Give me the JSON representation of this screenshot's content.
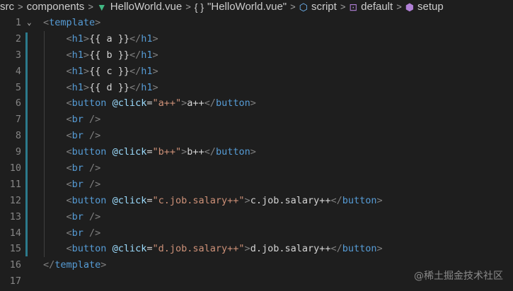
{
  "breadcrumb": {
    "segments": [
      {
        "label": "src",
        "icon": ""
      },
      {
        "label": "components",
        "icon": ""
      },
      {
        "label": "HelloWorld.vue",
        "icon": "vue-icon"
      },
      {
        "label": "\"HelloWorld.vue\"",
        "icon": "braces-icon"
      },
      {
        "label": "script",
        "icon": "cube-icon"
      },
      {
        "label": "default",
        "icon": "field-icon"
      },
      {
        "label": "setup",
        "icon": "method-icon"
      }
    ],
    "separator": ">"
  },
  "editor": {
    "lines": [
      {
        "no": "1",
        "tokens": [
          {
            "t": "<",
            "c": "bracket"
          },
          {
            "t": "template",
            "c": "tag"
          },
          {
            "t": ">",
            "c": "bracket"
          }
        ]
      },
      {
        "no": "2",
        "tokens": [
          {
            "t": "    ",
            "c": "txt"
          },
          {
            "t": "<",
            "c": "bracket"
          },
          {
            "t": "h1",
            "c": "tag"
          },
          {
            "t": ">",
            "c": "bracket"
          },
          {
            "t": "{{ a }}",
            "c": "txt"
          },
          {
            "t": "</",
            "c": "bracket"
          },
          {
            "t": "h1",
            "c": "tag"
          },
          {
            "t": ">",
            "c": "bracket"
          }
        ]
      },
      {
        "no": "3",
        "tokens": [
          {
            "t": "    ",
            "c": "txt"
          },
          {
            "t": "<",
            "c": "bracket"
          },
          {
            "t": "h1",
            "c": "tag"
          },
          {
            "t": ">",
            "c": "bracket"
          },
          {
            "t": "{{ b }}",
            "c": "txt"
          },
          {
            "t": "</",
            "c": "bracket"
          },
          {
            "t": "h1",
            "c": "tag"
          },
          {
            "t": ">",
            "c": "bracket"
          }
        ]
      },
      {
        "no": "4",
        "tokens": [
          {
            "t": "    ",
            "c": "txt"
          },
          {
            "t": "<",
            "c": "bracket"
          },
          {
            "t": "h1",
            "c": "tag"
          },
          {
            "t": ">",
            "c": "bracket"
          },
          {
            "t": "{{ c }}",
            "c": "txt"
          },
          {
            "t": "</",
            "c": "bracket"
          },
          {
            "t": "h1",
            "c": "tag"
          },
          {
            "t": ">",
            "c": "bracket"
          }
        ]
      },
      {
        "no": "5",
        "tokens": [
          {
            "t": "    ",
            "c": "txt"
          },
          {
            "t": "<",
            "c": "bracket"
          },
          {
            "t": "h1",
            "c": "tag"
          },
          {
            "t": ">",
            "c": "bracket"
          },
          {
            "t": "{{ d }}",
            "c": "txt"
          },
          {
            "t": "</",
            "c": "bracket"
          },
          {
            "t": "h1",
            "c": "tag"
          },
          {
            "t": ">",
            "c": "bracket"
          }
        ]
      },
      {
        "no": "6",
        "tokens": [
          {
            "t": "    ",
            "c": "txt"
          },
          {
            "t": "<",
            "c": "bracket"
          },
          {
            "t": "button",
            "c": "tag"
          },
          {
            "t": " ",
            "c": "txt"
          },
          {
            "t": "@click",
            "c": "attr"
          },
          {
            "t": "=",
            "c": "txt"
          },
          {
            "t": "\"a++\"",
            "c": "str"
          },
          {
            "t": ">",
            "c": "bracket"
          },
          {
            "t": "a++",
            "c": "txt"
          },
          {
            "t": "</",
            "c": "bracket"
          },
          {
            "t": "button",
            "c": "tag"
          },
          {
            "t": ">",
            "c": "bracket"
          }
        ]
      },
      {
        "no": "7",
        "tokens": [
          {
            "t": "    ",
            "c": "txt"
          },
          {
            "t": "<",
            "c": "bracket"
          },
          {
            "t": "br",
            "c": "tag"
          },
          {
            "t": " />",
            "c": "bracket"
          }
        ]
      },
      {
        "no": "8",
        "tokens": [
          {
            "t": "    ",
            "c": "txt"
          },
          {
            "t": "<",
            "c": "bracket"
          },
          {
            "t": "br",
            "c": "tag"
          },
          {
            "t": " />",
            "c": "bracket"
          }
        ]
      },
      {
        "no": "9",
        "tokens": [
          {
            "t": "    ",
            "c": "txt"
          },
          {
            "t": "<",
            "c": "bracket"
          },
          {
            "t": "button",
            "c": "tag"
          },
          {
            "t": " ",
            "c": "txt"
          },
          {
            "t": "@click",
            "c": "attr"
          },
          {
            "t": "=",
            "c": "txt"
          },
          {
            "t": "\"b++\"",
            "c": "str"
          },
          {
            "t": ">",
            "c": "bracket"
          },
          {
            "t": "b++",
            "c": "txt"
          },
          {
            "t": "</",
            "c": "bracket"
          },
          {
            "t": "button",
            "c": "tag"
          },
          {
            "t": ">",
            "c": "bracket"
          }
        ]
      },
      {
        "no": "10",
        "tokens": [
          {
            "t": "    ",
            "c": "txt"
          },
          {
            "t": "<",
            "c": "bracket"
          },
          {
            "t": "br",
            "c": "tag"
          },
          {
            "t": " />",
            "c": "bracket"
          }
        ]
      },
      {
        "no": "11",
        "tokens": [
          {
            "t": "    ",
            "c": "txt"
          },
          {
            "t": "<",
            "c": "bracket"
          },
          {
            "t": "br",
            "c": "tag"
          },
          {
            "t": " />",
            "c": "bracket"
          }
        ]
      },
      {
        "no": "12",
        "tokens": [
          {
            "t": "    ",
            "c": "txt"
          },
          {
            "t": "<",
            "c": "bracket"
          },
          {
            "t": "button",
            "c": "tag"
          },
          {
            "t": " ",
            "c": "txt"
          },
          {
            "t": "@click",
            "c": "attr"
          },
          {
            "t": "=",
            "c": "txt"
          },
          {
            "t": "\"c.job.salary++\"",
            "c": "str"
          },
          {
            "t": ">",
            "c": "bracket"
          },
          {
            "t": "c.job.salary++",
            "c": "txt"
          },
          {
            "t": "</",
            "c": "bracket"
          },
          {
            "t": "button",
            "c": "tag"
          },
          {
            "t": ">",
            "c": "bracket"
          }
        ]
      },
      {
        "no": "13",
        "tokens": [
          {
            "t": "    ",
            "c": "txt"
          },
          {
            "t": "<",
            "c": "bracket"
          },
          {
            "t": "br",
            "c": "tag"
          },
          {
            "t": " />",
            "c": "bracket"
          }
        ]
      },
      {
        "no": "14",
        "tokens": [
          {
            "t": "    ",
            "c": "txt"
          },
          {
            "t": "<",
            "c": "bracket"
          },
          {
            "t": "br",
            "c": "tag"
          },
          {
            "t": " />",
            "c": "bracket"
          }
        ]
      },
      {
        "no": "15",
        "tokens": [
          {
            "t": "    ",
            "c": "txt"
          },
          {
            "t": "<",
            "c": "bracket"
          },
          {
            "t": "button",
            "c": "tag"
          },
          {
            "t": " ",
            "c": "txt"
          },
          {
            "t": "@click",
            "c": "attr"
          },
          {
            "t": "=",
            "c": "txt"
          },
          {
            "t": "\"d.job.salary++\"",
            "c": "str"
          },
          {
            "t": ">",
            "c": "bracket"
          },
          {
            "t": "d.job.salary++",
            "c": "txt"
          },
          {
            "t": "</",
            "c": "bracket"
          },
          {
            "t": "button",
            "c": "tag"
          },
          {
            "t": ">",
            "c": "bracket"
          }
        ]
      },
      {
        "no": "16",
        "tokens": [
          {
            "t": "</",
            "c": "bracket"
          },
          {
            "t": "template",
            "c": "tag"
          },
          {
            "t": ">",
            "c": "bracket"
          }
        ]
      },
      {
        "no": "17",
        "tokens": []
      }
    ],
    "folded_line_no": "1",
    "colors": {
      "background": "#1e1e1e",
      "tag": "#569cd6",
      "attribute": "#9cdcfe",
      "string": "#ce9178",
      "bracket": "#808080",
      "text": "#d4d4d4",
      "line_number": "#858585",
      "modified_bar": "#2c7a8c"
    }
  },
  "watermark": "@稀土掘金技术社区"
}
